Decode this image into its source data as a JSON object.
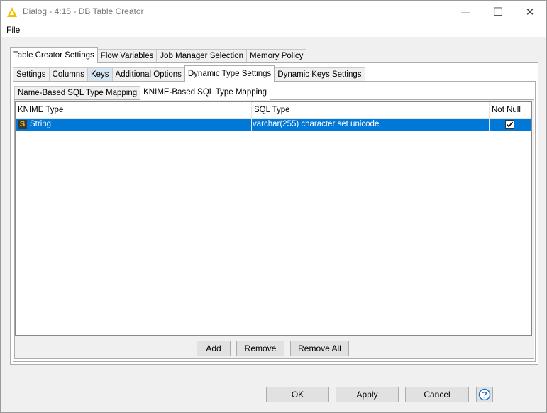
{
  "window": {
    "title": "Dialog - 4:15 - DB Table Creator",
    "controls": {
      "minimize": "—",
      "maximize": "☐",
      "close": "✕"
    }
  },
  "menu": {
    "file": "File"
  },
  "tabs_main": [
    {
      "label": "Table Creator Settings",
      "selected": true
    },
    {
      "label": "Flow Variables",
      "selected": false
    },
    {
      "label": "Job Manager Selection",
      "selected": false
    },
    {
      "label": "Memory Policy",
      "selected": false
    }
  ],
  "tabs_sub": [
    {
      "label": "Settings",
      "selected": false
    },
    {
      "label": "Columns",
      "selected": false
    },
    {
      "label": "Keys",
      "selected": false,
      "hover": true
    },
    {
      "label": "Additional Options",
      "selected": false
    },
    {
      "label": "Dynamic Type Settings",
      "selected": true
    },
    {
      "label": "Dynamic Keys Settings",
      "selected": false
    }
  ],
  "tabs_mapping": [
    {
      "label": "Name-Based SQL Type Mapping",
      "selected": false
    },
    {
      "label": "KNIME-Based SQL Type Mapping",
      "selected": true
    }
  ],
  "table": {
    "headers": {
      "knime_type": "KNIME Type",
      "sql_type": "SQL Type",
      "not_null": "Not Null"
    },
    "rows": [
      {
        "type_badge": "S",
        "knime_type": "String",
        "sql_type": "varchar(255) character set unicode",
        "not_null": true
      }
    ]
  },
  "table_buttons": {
    "add": "Add",
    "remove": "Remove",
    "remove_all": "Remove All"
  },
  "dialog_buttons": {
    "ok": "OK",
    "apply": "Apply",
    "cancel": "Cancel"
  },
  "colors": {
    "selection": "#0078d7",
    "warning_icon": "#f5c000"
  }
}
